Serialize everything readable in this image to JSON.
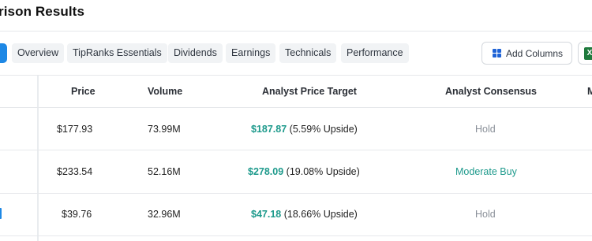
{
  "page": {
    "title": "rison Results"
  },
  "tabs": [
    "Overview",
    "TipRanks Essentials",
    "Dividends",
    "Earnings",
    "Technicals",
    "Performance"
  ],
  "toolbar": {
    "add_columns_label": "Add Columns",
    "excel_label": "X"
  },
  "table": {
    "headers": {
      "price": "Price",
      "volume": "Volume",
      "target": "Analyst Price Target",
      "consensus": "Analyst Consensus",
      "more": "M"
    },
    "rows": [
      {
        "price": "$177.93",
        "volume": "73.99M",
        "target": "$187.87",
        "upside": "(5.59% Upside)",
        "consensus": "Hold"
      },
      {
        "price": "$233.54",
        "volume": "52.16M",
        "target": "$278.09",
        "upside": "(19.08% Upside)",
        "consensus": "Moderate Buy"
      },
      {
        "price": "$39.76",
        "volume": "32.96M",
        "target": "$47.18",
        "upside": "(18.66% Upside)",
        "consensus": "Hold"
      }
    ]
  },
  "colors": {
    "accent": "#1e88e5",
    "positive": "#1e9a8c",
    "neutral": "#8a9099",
    "excel": "#1f7a3d"
  }
}
